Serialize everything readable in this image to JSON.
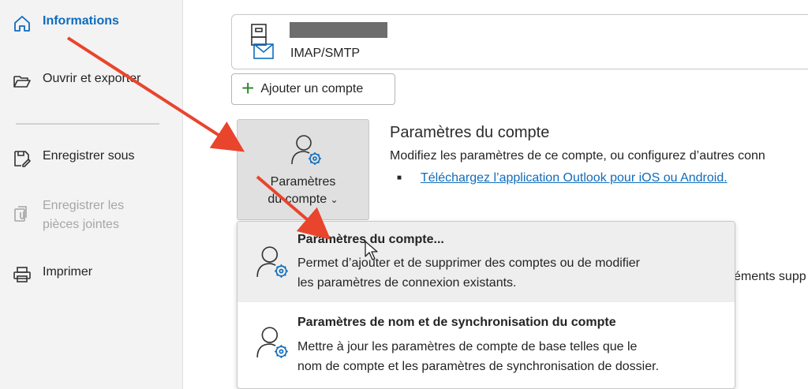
{
  "sidebar": {
    "items": [
      {
        "label": "Informations",
        "icon": "home-icon",
        "state": "active"
      },
      {
        "label": "Ouvrir et exporter",
        "icon": "folder-open-icon",
        "state": "normal"
      },
      {
        "label": "Enregistrer sous",
        "icon": "save-as-icon",
        "state": "normal"
      },
      {
        "label_line1": "Enregistrer les",
        "label_line2": "pièces jointes",
        "icon": "attachments-icon",
        "state": "disabled"
      },
      {
        "label": "Imprimer",
        "icon": "printer-icon",
        "state": "normal"
      }
    ]
  },
  "account": {
    "type": "IMAP/SMTP",
    "icon": "mailbox-icon"
  },
  "add_account": {
    "label": "Ajouter un compte",
    "icon": "plus-icon"
  },
  "settings_tile": {
    "line1": "Paramètres",
    "line2": "du compte",
    "chevron": "⌄",
    "icon": "account-settings-icon"
  },
  "account_settings": {
    "title": "Paramètres du compte",
    "description": "Modifiez les paramètres de ce compte, ou configurez d’autres conn",
    "link": "Téléchargez l’application Outlook pour iOS ou Android."
  },
  "partial_text": "éments supp",
  "dropdown": {
    "items": [
      {
        "title": "Paramètres du compte...",
        "desc_line1": "Permet d’ajouter et de supprimer des comptes ou de modifier",
        "desc_line2": "les paramètres de connexion existants.",
        "icon": "account-settings-icon"
      },
      {
        "title": "Paramètres de nom et de synchronisation du compte",
        "desc_line1": "Mettre à jour les paramètres de compte de base telles que le",
        "desc_line2": "nom de compte et les paramètres de synchronisation de dossier.",
        "icon": "account-settings-icon"
      }
    ]
  },
  "colors": {
    "accent": "#0f6cbd",
    "arrow": "#e8452c",
    "sidebar_bg": "#f3f3f3",
    "tile_bg": "#e0e0e0"
  }
}
